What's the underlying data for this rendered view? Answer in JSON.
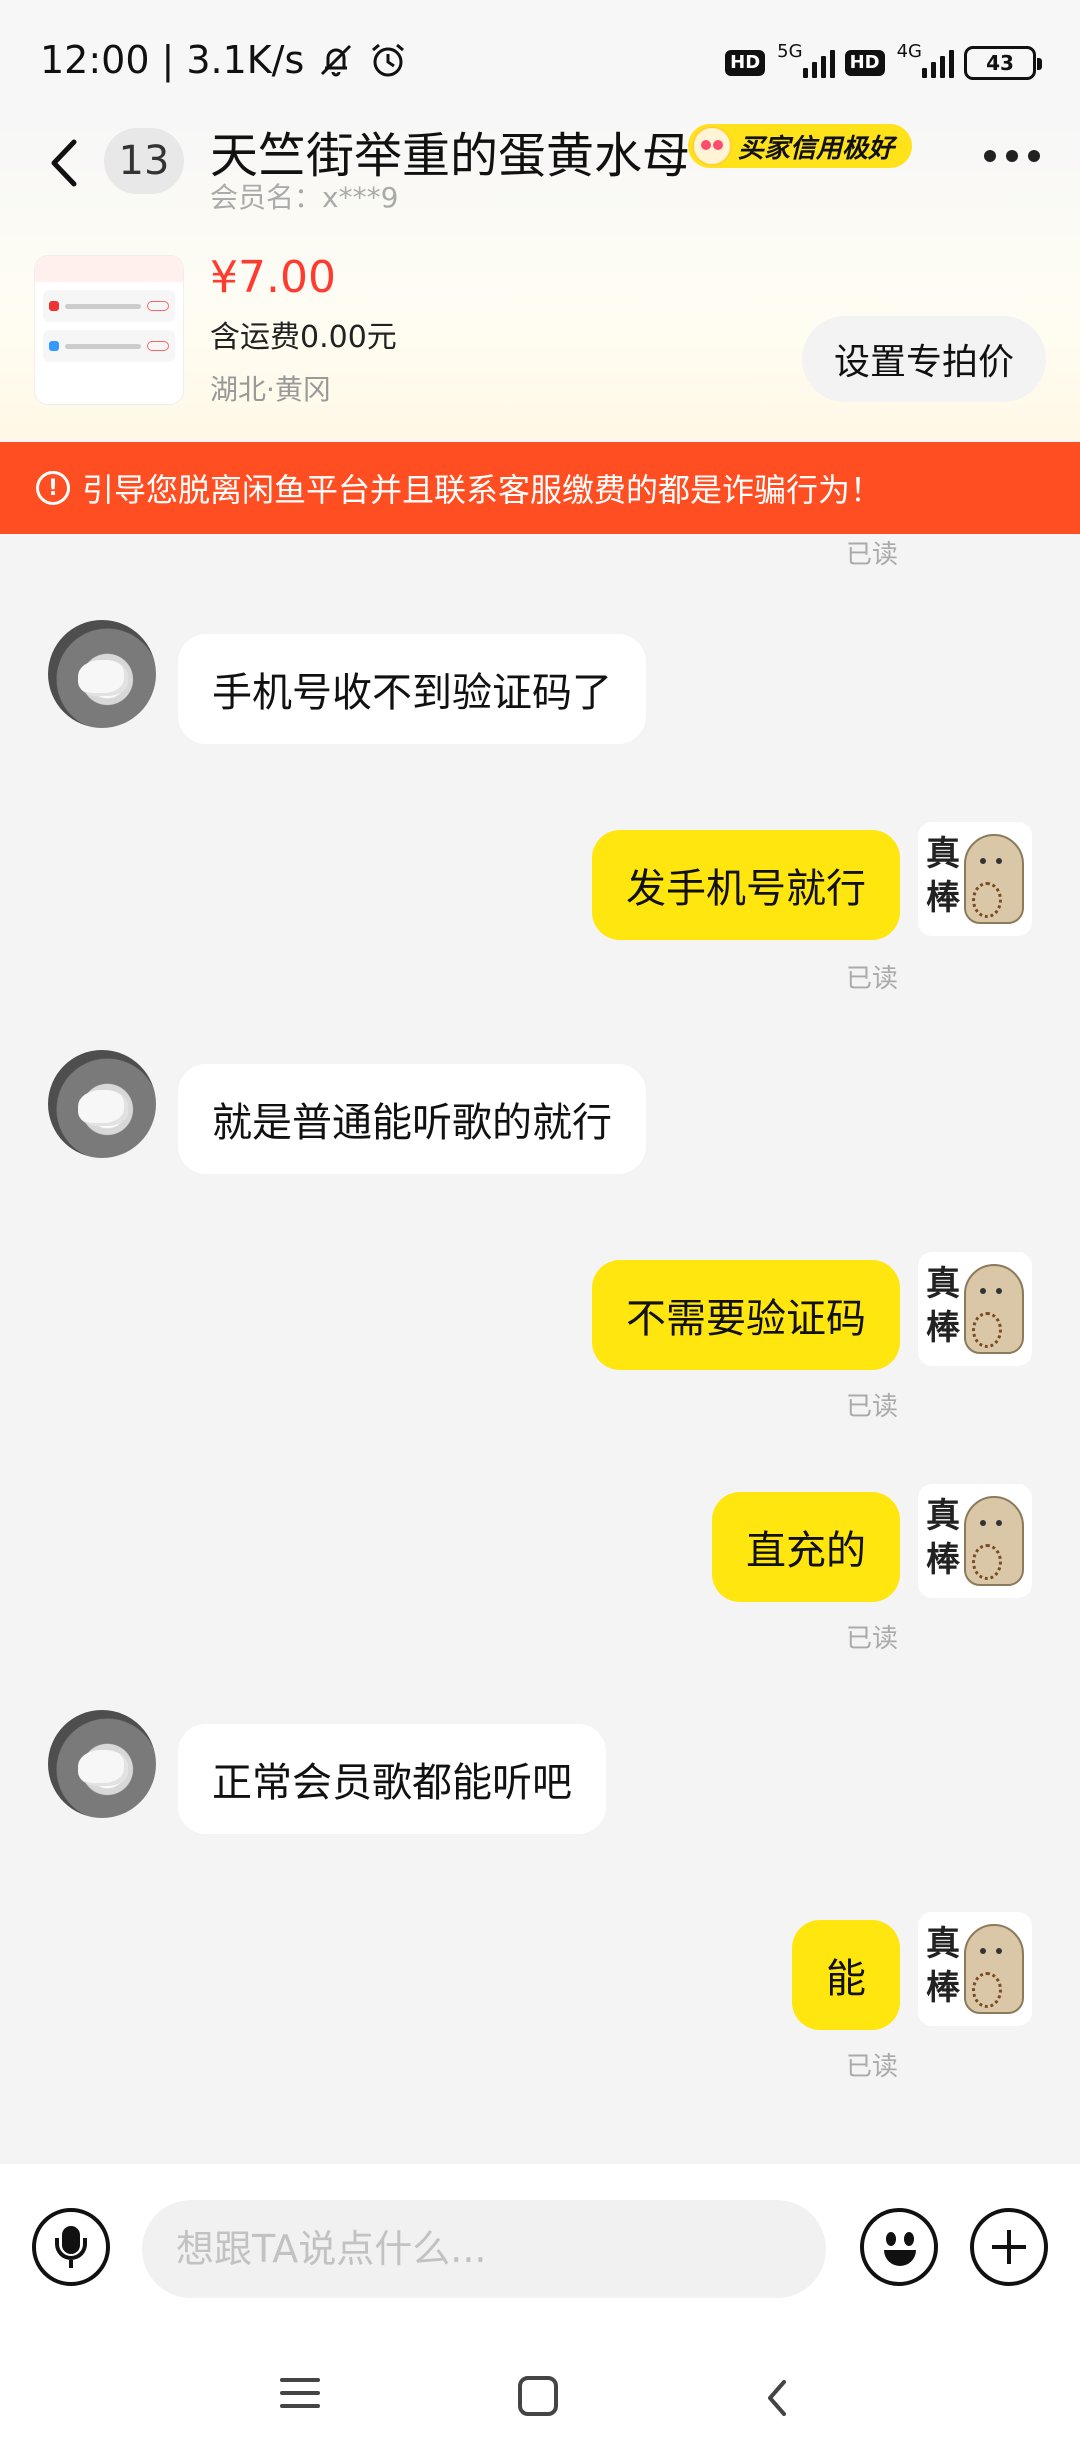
{
  "status_bar": {
    "time": "12:00",
    "separator": "|",
    "speed": "3.1K/s",
    "sim1_network": "5G",
    "sim2_network": "4G",
    "hd_label": "HD",
    "battery": "43"
  },
  "header": {
    "unread_count": "13",
    "contact_name": "天竺街举重的蛋黄水母",
    "credit_badge": "买家信用极好",
    "member_label": "会员名：x***9"
  },
  "product": {
    "price": "¥7.00",
    "shipping": "含运费0.00元",
    "location": "湖北·黄冈",
    "special_price_button": "设置专拍价"
  },
  "warning": {
    "text": "引导您脱离闲鱼平台并且联系客服缴费的都是诈骗行为！"
  },
  "chat": {
    "read_label": "已读",
    "messages": [
      {
        "from": "them",
        "text": "手机号收不到验证码了"
      },
      {
        "from": "me",
        "text": "发手机号就行",
        "status": "已读"
      },
      {
        "from": "them",
        "text": "就是普通能听歌的就行"
      },
      {
        "from": "me",
        "text": "不需要验证码",
        "status": "已读"
      },
      {
        "from": "me",
        "text": "直充的",
        "status": "已读"
      },
      {
        "from": "them",
        "text": "正常会员歌都能听吧"
      },
      {
        "from": "me",
        "text": "能",
        "status": "已读"
      }
    ]
  },
  "avatar_me_text": "真棒",
  "input": {
    "placeholder": "想跟TA说点什么..."
  },
  "icons": {
    "back": "chevron-left-icon",
    "more": "more-dots-icon",
    "mic": "microphone-icon",
    "emoji": "emoji-icon",
    "plus": "plus-icon",
    "warning": "exclamation-circle-icon"
  },
  "colors": {
    "accent_yellow": "#ffe60f",
    "price_red": "#ff3b30",
    "warning_orange": "#ff4f22"
  }
}
